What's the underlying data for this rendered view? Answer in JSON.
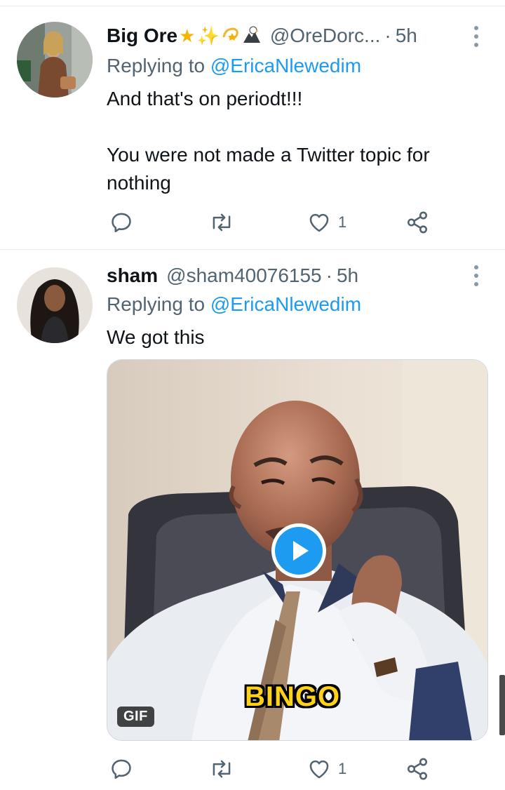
{
  "colors": {
    "link_blue": "#1d9bf0",
    "secondary_text": "#536471",
    "primary_text": "#0f1419",
    "divider": "#e6ecf0"
  },
  "tweets": [
    {
      "display_name": "Big Ore",
      "name_emojis": [
        "star",
        "sparkles",
        "dizzy",
        "eagle"
      ],
      "handle": "@OreDorc...",
      "time": "5h",
      "replying_prefix": "Replying to",
      "replying_to": "@EricaNlewedim",
      "paragraphs": [
        "And that's on periodt!!!",
        "You were not made a Twitter topic for nothing"
      ],
      "actions": {
        "reply_count": "",
        "retweet_count": "",
        "like_count": "1"
      }
    },
    {
      "display_name": "sham",
      "handle": "@sham40076155",
      "time": "5h",
      "replying_prefix": "Replying to",
      "replying_to": "@EricaNlewedim",
      "paragraphs": [
        "We got this"
      ],
      "media": {
        "type": "gif",
        "badge": "GIF",
        "caption": "BINGO",
        "play_icon": "play-icon"
      },
      "actions": {
        "reply_count": "",
        "retweet_count": "",
        "like_count": "1"
      }
    }
  ]
}
